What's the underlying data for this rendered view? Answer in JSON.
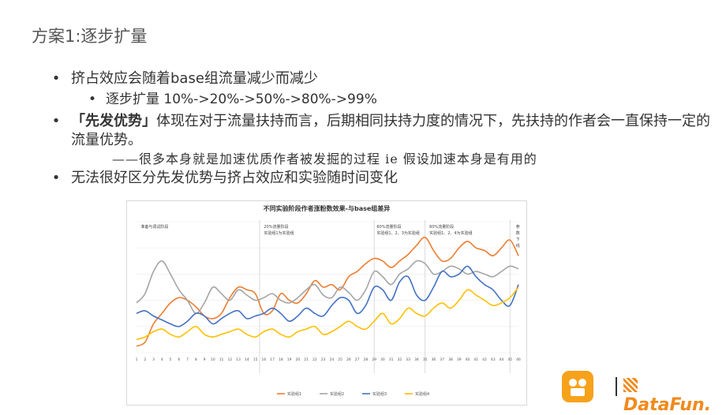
{
  "slide": {
    "title": "方案1:逐步扩量",
    "bullets": [
      {
        "bullet": "•",
        "text": "挤占效应会随着base组流量减少而减少"
      },
      {
        "bullet": "•",
        "text": "逐步扩量 10%->20%->50%->80%->99%"
      },
      {
        "bullet": "•",
        "text_bold": "「先发优势」",
        "text": "体现在对于流量扶持而言，后期相同扶持力度的情况下，先扶持的作者会一直保持一定的流量优势。"
      },
      {
        "text": "——很多本身就是加速优质作者被发掘的过程  ie 假设加速本身是有用的"
      },
      {
        "bullet": "•",
        "text": "无法很好区分先发优势与挤占效应和实验随时间变化"
      }
    ]
  },
  "chart_data": {
    "type": "line",
    "title": "不同实验阶段作者涨粉数效果-与base组差异",
    "x": [
      1,
      2,
      3,
      4,
      5,
      6,
      7,
      8,
      9,
      10,
      11,
      12,
      13,
      14,
      15,
      16,
      17,
      18,
      19,
      20,
      21,
      22,
      23,
      24,
      25,
      26,
      27,
      28,
      29,
      30,
      31,
      32,
      33,
      34,
      35,
      36,
      37,
      38,
      39,
      40,
      41,
      42,
      43,
      44,
      45,
      46
    ],
    "ylim": [
      0,
      100
    ],
    "phase_labels": [
      {
        "lines": [
          "准备与调试阶段"
        ],
        "x": 1.5
      },
      {
        "lines": [
          "20%流量阶段",
          "实验组1为实验组"
        ],
        "x": 16
      },
      {
        "lines": [
          "60%流量阶段",
          "实验组1、2、3为实验组"
        ],
        "x": 29.3
      },
      {
        "lines": [
          "60%流量阶段",
          "实验组1、2、4为实验组"
        ],
        "x": 35.5
      },
      {
        "lines": [
          "参",
          "数",
          "下",
          "线"
        ],
        "x": 45.7
      }
    ],
    "phase_dividers": [
      15.5,
      29,
      35,
      45
    ],
    "series": [
      {
        "name": "实验组1",
        "color": "#ed7d31",
        "values": [
          5,
          8,
          22,
          30,
          38,
          42,
          40,
          35,
          28,
          26,
          30,
          42,
          50,
          48,
          45,
          30,
          32,
          45,
          40,
          38,
          45,
          55,
          50,
          52,
          48,
          58,
          62,
          68,
          72,
          70,
          65,
          70,
          75,
          82,
          88,
          78,
          70,
          72,
          80,
          85,
          80,
          78,
          74,
          80,
          86,
          74
        ]
      },
      {
        "name": "实验组2",
        "color": "#a5a5a5",
        "values": [
          38,
          45,
          62,
          70,
          60,
          48,
          40,
          30,
          38,
          50,
          45,
          40,
          48,
          44,
          40,
          42,
          45,
          40,
          38,
          42,
          48,
          52,
          44,
          42,
          50,
          46,
          40,
          48,
          62,
          58,
          52,
          60,
          64,
          70,
          68,
          60,
          62,
          66,
          64,
          60,
          62,
          60,
          58,
          62,
          66,
          64
        ]
      },
      {
        "name": "实验组3",
        "color": "#4472c4",
        "values": [
          30,
          32,
          28,
          25,
          22,
          20,
          24,
          30,
          28,
          22,
          26,
          30,
          32,
          26,
          28,
          30,
          34,
          30,
          24,
          28,
          34,
          30,
          28,
          36,
          42,
          40,
          30,
          36,
          50,
          48,
          40,
          54,
          58,
          44,
          40,
          50,
          62,
          58,
          60,
          66,
          58,
          52,
          48,
          40,
          36,
          52
        ]
      },
      {
        "name": "实验组4",
        "color": "#ffc000",
        "values": [
          10,
          12,
          16,
          18,
          14,
          12,
          16,
          20,
          14,
          12,
          14,
          16,
          18,
          14,
          12,
          16,
          18,
          14,
          12,
          16,
          18,
          20,
          14,
          16,
          20,
          24,
          20,
          18,
          24,
          30,
          22,
          26,
          34,
          30,
          28,
          34,
          38,
          34,
          40,
          48,
          44,
          40,
          36,
          38,
          42,
          50
        ]
      }
    ],
    "legend_position": "bottom"
  }
}
